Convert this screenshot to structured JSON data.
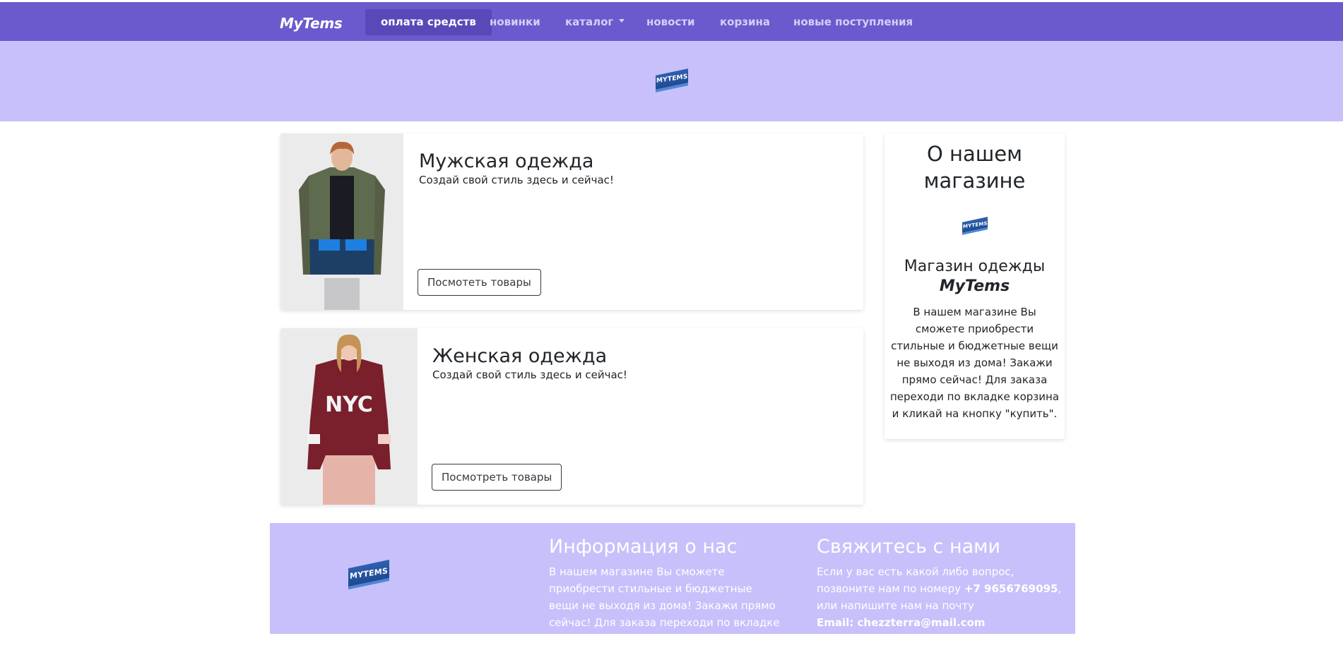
{
  "navbar": {
    "brand": "MyTems",
    "items": [
      {
        "label": "оплата средств",
        "active": true
      },
      {
        "label": "новинки"
      },
      {
        "label": "каталог"
      },
      {
        "label": "новости"
      },
      {
        "label": "корзина"
      },
      {
        "label": "новые поступления"
      }
    ]
  },
  "logo_text": "MYTEMS",
  "cards": [
    {
      "title": "Мужская одежда",
      "text": "Создай свой стиль здесь и сейчас!",
      "button": "Посмотеть товары"
    },
    {
      "title": "Женская одежда",
      "text": "Создай свой стиль здесь и сейчас!",
      "button": "Посмотреть товары"
    }
  ],
  "aside": {
    "title": "О нашем магазине",
    "subtitle": "Магазин одежды",
    "brand": "MyTems",
    "text": "В нашем магазине Вы сможете приобрести стильные и бюджетные вещи не выходя из дома! Закажи прямо сейчас! Для заказа переходи по вкладке корзина и кликай на кнопку \"купить\"."
  },
  "footer": {
    "info_title": "Информация о нас",
    "info_text": "В нашем магазине Вы сможете приобрести стильные и бюджетные вещи не выходя из дома! Закажи прямо сейчас! Для заказа переходи по вкладке корзина и кликай на",
    "contact_title": "Свяжитесь с нами",
    "contact_text_1": "Если у вас есть какой либо вопрос, позвоните нам по номеру ",
    "phone": "+7 9656769095",
    "contact_text_2": ", или напишите нам на почту",
    "email_label": "Email: ",
    "email": "chezzterra@mail.com"
  },
  "colors": {
    "navbar": "#6a5acd",
    "nav_active": "#5849b8",
    "hero": "#c7c0fb",
    "footer": "#c7c0fb"
  }
}
